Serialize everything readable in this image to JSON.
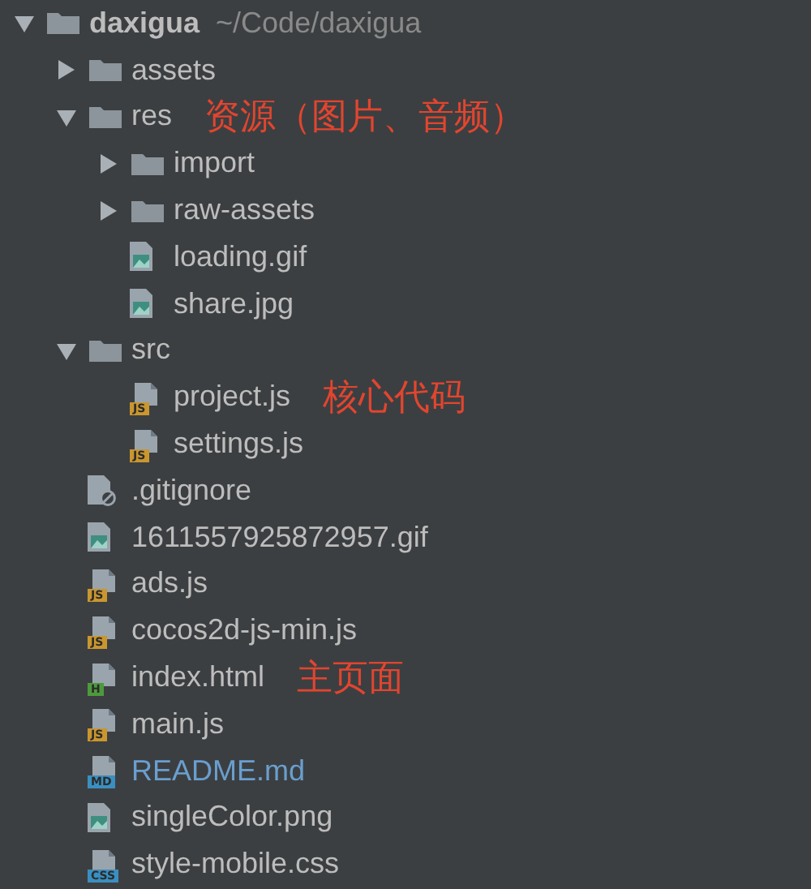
{
  "tree": {
    "name": "daxigua",
    "path": "~/Code/daxigua",
    "kind": "folder",
    "expanded": true,
    "modified": false,
    "children": [
      {
        "name": "assets",
        "kind": "folder",
        "expanded": false,
        "modified": false
      },
      {
        "name": "res",
        "kind": "folder",
        "expanded": true,
        "modified": false,
        "note": "资源（图片、音频）",
        "children": [
          {
            "name": "import",
            "kind": "folder",
            "expanded": false,
            "modified": false
          },
          {
            "name": "raw-assets",
            "kind": "folder",
            "expanded": false,
            "modified": false
          },
          {
            "name": "loading.gif",
            "kind": "image",
            "modified": false
          },
          {
            "name": "share.jpg",
            "kind": "image",
            "modified": false
          }
        ]
      },
      {
        "name": "src",
        "kind": "folder",
        "expanded": true,
        "modified": false,
        "children": [
          {
            "name": "project.js",
            "kind": "badge",
            "badge": "JS",
            "color": "#c9962f",
            "modified": false,
            "note": "核心代码"
          },
          {
            "name": "settings.js",
            "kind": "badge",
            "badge": "JS",
            "color": "#c9962f",
            "modified": false
          }
        ]
      },
      {
        "name": ".gitignore",
        "kind": "ignored",
        "modified": false
      },
      {
        "name": "1611557925872957.gif",
        "kind": "image",
        "modified": false
      },
      {
        "name": "ads.js",
        "kind": "badge",
        "badge": "JS",
        "color": "#c9962f",
        "modified": false
      },
      {
        "name": "cocos2d-js-min.js",
        "kind": "badge",
        "badge": "JS",
        "color": "#c9962f",
        "modified": false
      },
      {
        "name": "index.html",
        "kind": "badge",
        "badge": "H",
        "color": "#4d9a3c",
        "modified": false,
        "note": "主页面"
      },
      {
        "name": "main.js",
        "kind": "badge",
        "badge": "JS",
        "color": "#c9962f",
        "modified": false
      },
      {
        "name": "README.md",
        "kind": "badge",
        "badge": "MD",
        "color": "#3a8fc0",
        "modified": true
      },
      {
        "name": "singleColor.png",
        "kind": "image",
        "modified": false
      },
      {
        "name": "style-mobile.css",
        "kind": "badge",
        "badge": "CSS",
        "color": "#3a8fc0",
        "modified": false
      }
    ]
  }
}
